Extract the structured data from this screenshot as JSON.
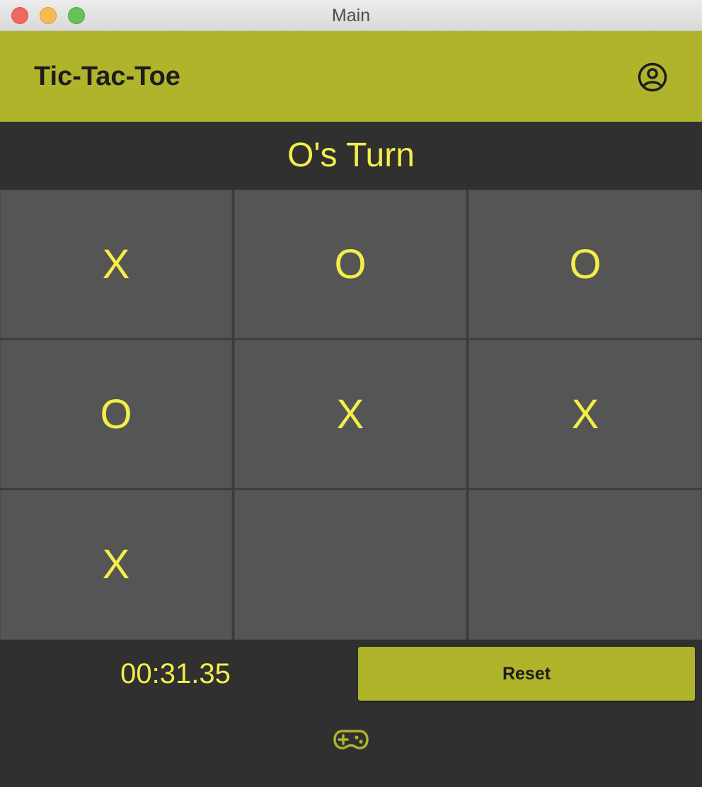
{
  "window": {
    "title": "Main"
  },
  "header": {
    "title": "Tic-Tac-Toe",
    "account_icon": "account-circle-icon"
  },
  "status": {
    "turn_text": "O's Turn"
  },
  "board": {
    "cells": [
      "X",
      "O",
      "O",
      "O",
      "X",
      "X",
      "X",
      "",
      ""
    ]
  },
  "controls": {
    "timer": "00:31.35",
    "reset_label": "Reset"
  },
  "nav": {
    "game_icon": "gamepad-icon"
  },
  "colors": {
    "accent": "#afb42b",
    "mark": "#f3ee48",
    "cell": "#555555",
    "background": "#303030"
  }
}
